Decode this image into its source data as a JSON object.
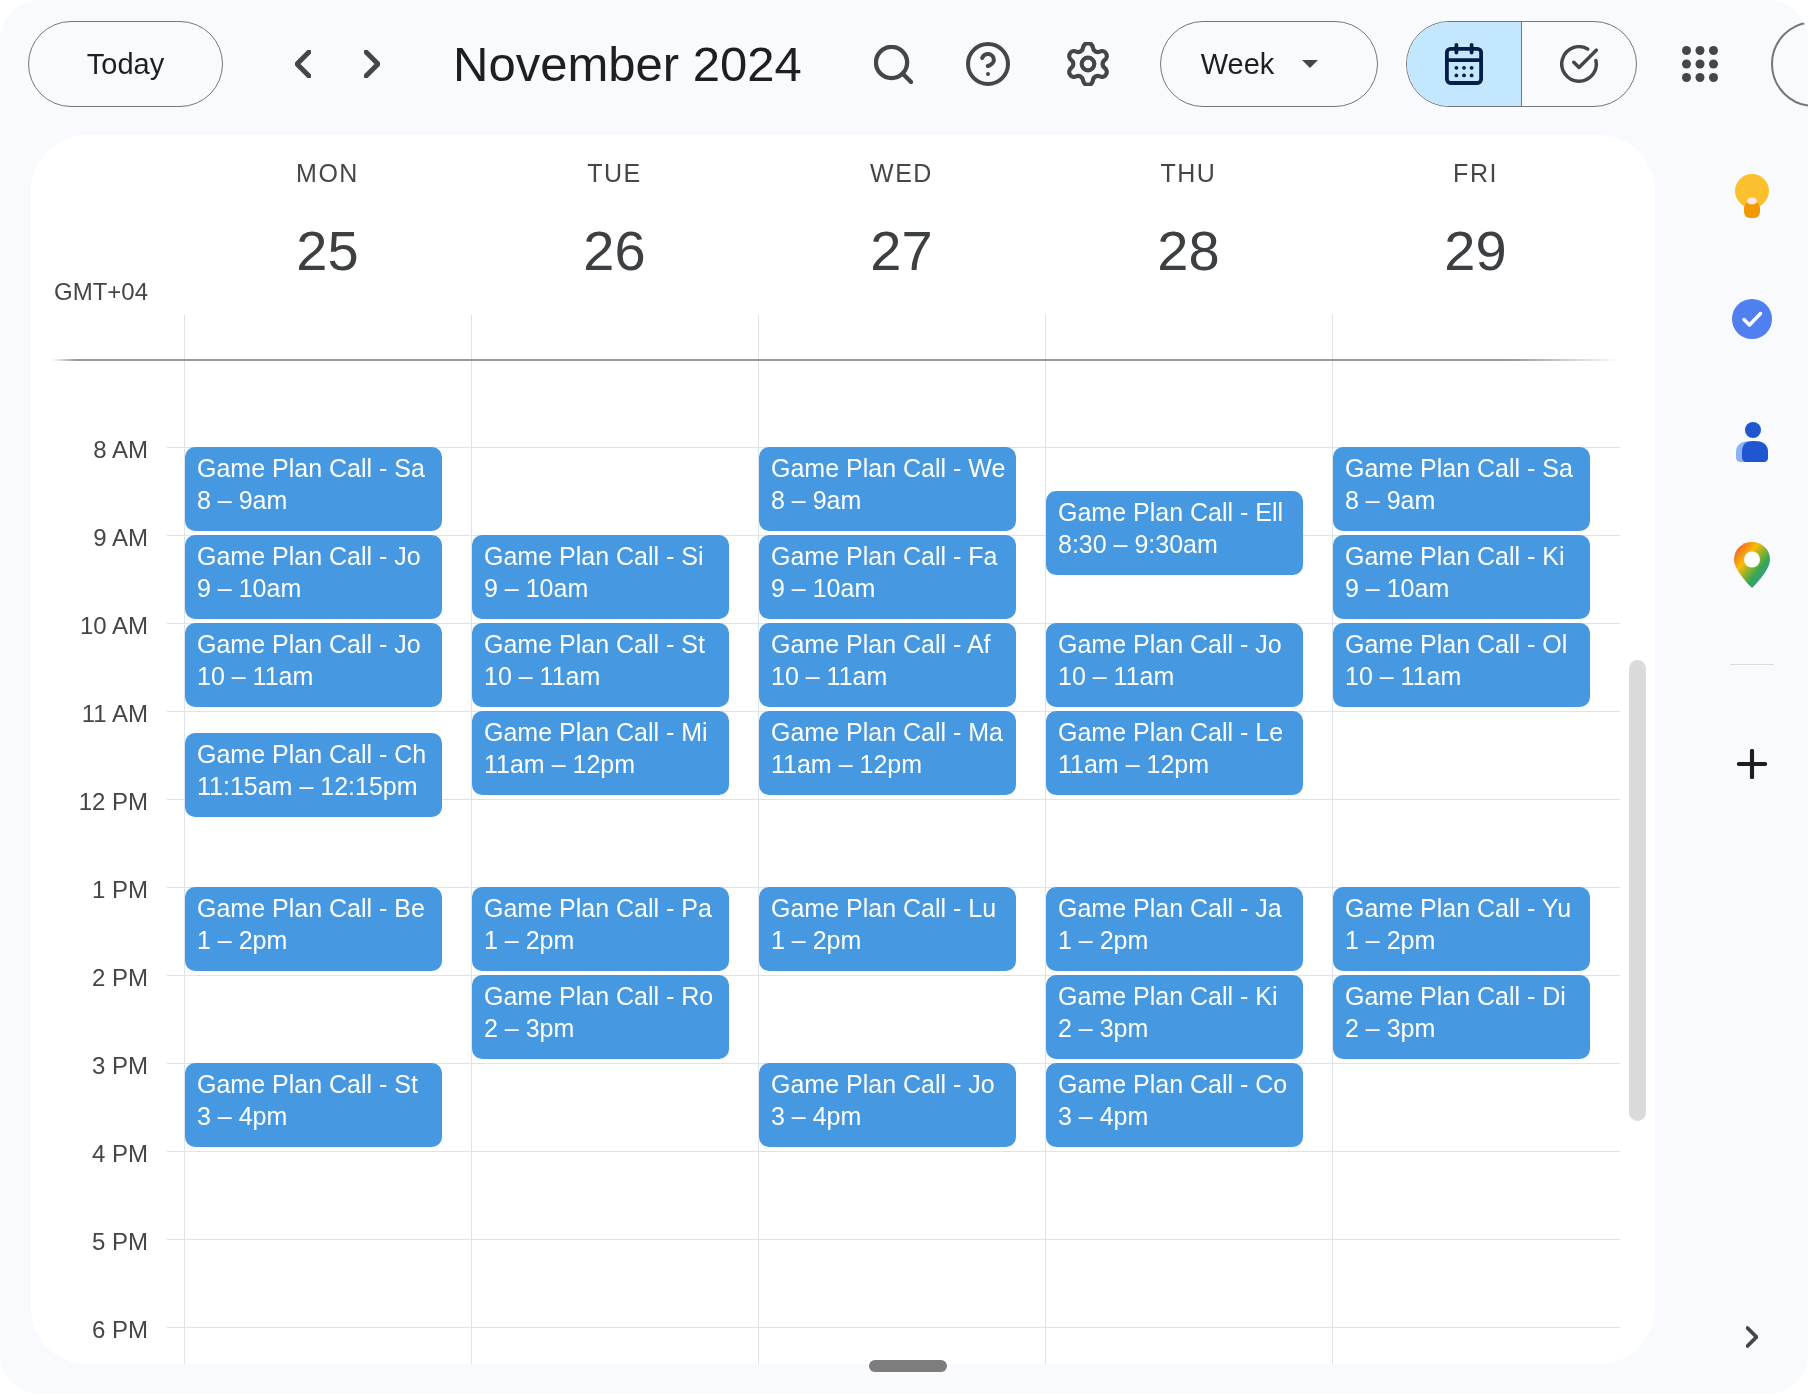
{
  "toolbar": {
    "today_button": "Today",
    "title": "November 2024",
    "view_select": "Week",
    "view_toggle": [
      {
        "kind": "calendar",
        "selected": true
      },
      {
        "kind": "tasks",
        "selected": false
      }
    ]
  },
  "calendar": {
    "timezone": "GMT+04",
    "hours": [
      "8 AM",
      "9 AM",
      "10 AM",
      "11 AM",
      "12 PM",
      "1 PM",
      "2 PM",
      "3 PM",
      "4 PM",
      "5 PM",
      "6 PM"
    ],
    "days": [
      {
        "weekday": "MON",
        "date": "25",
        "events": [
          {
            "title": "Game Plan Call - Sa",
            "time": "8 – 9am"
          },
          {
            "title": "Game Plan Call - Jo",
            "time": "9 – 10am"
          },
          {
            "title": "Game Plan Call - Jo",
            "time": "10 – 11am"
          },
          {
            "title": "Game Plan Call - Ch",
            "time": "11:15am – 12:15pm"
          },
          {
            "title": "Game Plan Call - Be",
            "time": "1 – 2pm"
          },
          {
            "title": "Game Plan Call - St",
            "time": "3 – 4pm"
          }
        ]
      },
      {
        "weekday": "TUE",
        "date": "26",
        "events": [
          {
            "title": "Game Plan Call - Si",
            "time": "9 – 10am"
          },
          {
            "title": "Game Plan Call - St",
            "time": "10 – 11am"
          },
          {
            "title": "Game Plan Call - Mi",
            "time": "11am – 12pm"
          },
          {
            "title": "Game Plan Call - Pa",
            "time": "1 – 2pm"
          },
          {
            "title": "Game Plan Call - Ro",
            "time": "2 – 3pm"
          }
        ]
      },
      {
        "weekday": "WED",
        "date": "27",
        "events": [
          {
            "title": "Game Plan Call - We",
            "time": "8 – 9am"
          },
          {
            "title": "Game Plan Call - Fa",
            "time": "9 – 10am"
          },
          {
            "title": "Game Plan Call - Af",
            "time": "10 – 11am"
          },
          {
            "title": "Game Plan Call - Ma",
            "time": "11am – 12pm"
          },
          {
            "title": "Game Plan Call - Lu",
            "time": "1 – 2pm"
          },
          {
            "title": "Game Plan Call - Jo",
            "time": "3 – 4pm"
          }
        ]
      },
      {
        "weekday": "THU",
        "date": "28",
        "events": [
          {
            "title": "Game Plan Call - Ell",
            "time": "8:30 – 9:30am"
          },
          {
            "title": "Game Plan Call - Jo",
            "time": "10 – 11am"
          },
          {
            "title": "Game Plan Call - Le",
            "time": "11am – 12pm"
          },
          {
            "title": "Game Plan Call - Ja",
            "time": "1 – 2pm"
          },
          {
            "title": "Game Plan Call - Ki",
            "time": "2 – 3pm"
          },
          {
            "title": "Game Plan Call - Co",
            "time": "3 – 4pm"
          }
        ]
      },
      {
        "weekday": "FRI",
        "date": "29",
        "events": [
          {
            "title": "Game Plan Call - Sa",
            "time": "8 – 9am"
          },
          {
            "title": "Game Plan Call - Ki",
            "time": "9 – 10am"
          },
          {
            "title": "Game Plan Call - Ol",
            "time": "10 – 11am"
          },
          {
            "title": "Game Plan Call - Yu",
            "time": "1 – 2pm"
          },
          {
            "title": "Game Plan Call - Di",
            "time": "2 – 3pm"
          }
        ]
      }
    ]
  }
}
